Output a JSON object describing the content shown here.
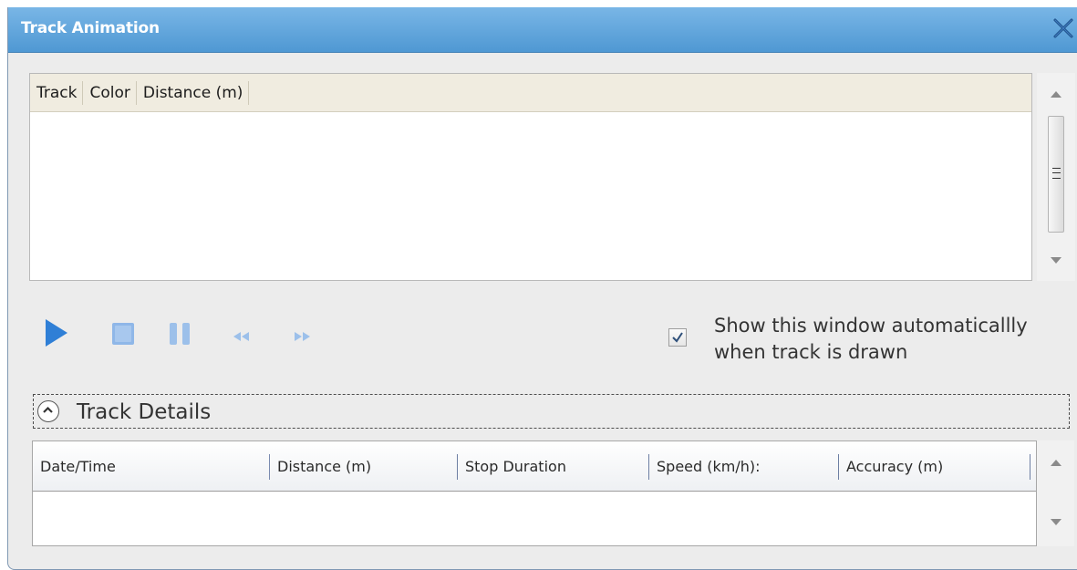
{
  "window": {
    "title": "Track Animation",
    "close_icon": "close-icon"
  },
  "tracks_grid": {
    "columns": [
      "Track",
      "Color",
      "Distance (m)"
    ],
    "rows": []
  },
  "playback": {
    "buttons": [
      "play-icon",
      "stop-icon",
      "pause-icon",
      "rewind-icon",
      "fast-forward-icon"
    ],
    "play_color": "#2f7fd6",
    "disabled_color": "#9cc0ea"
  },
  "auto_show": {
    "checked": true,
    "label_line1": "Show this window automaticallly",
    "label_line2": "when track is drawn"
  },
  "track_details": {
    "label": "Track Details",
    "expanded": true,
    "columns": [
      "Date/Time",
      "Distance (m)",
      "Stop Duration",
      "Speed (km/h):",
      "Accuracy (m)"
    ],
    "rows": []
  }
}
